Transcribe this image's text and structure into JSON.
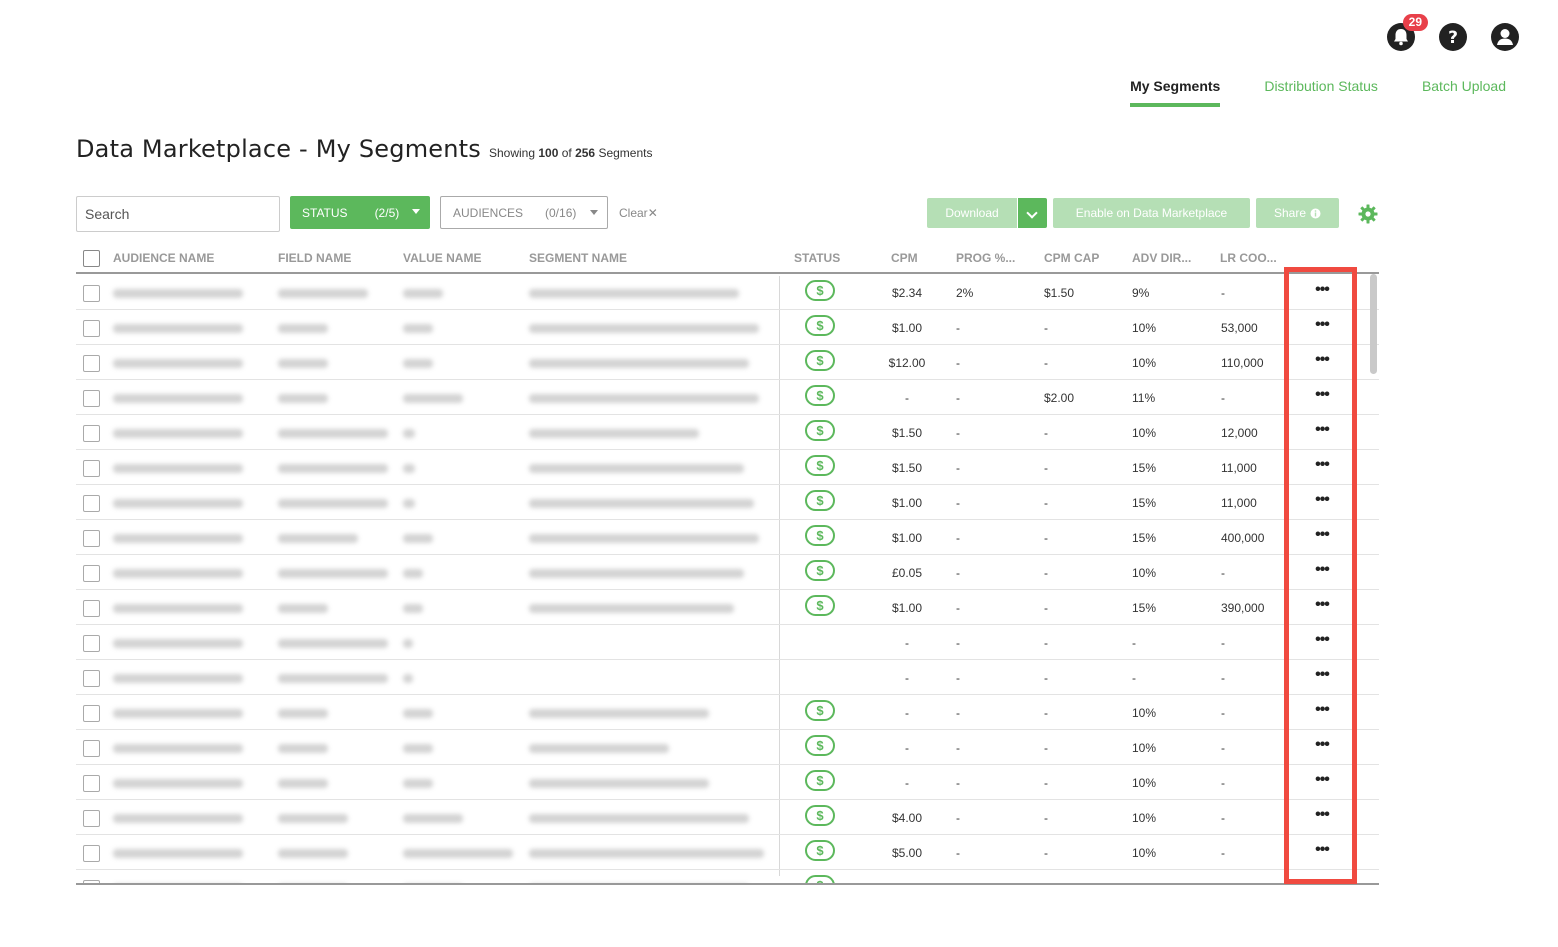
{
  "header": {
    "notifications_count": "29",
    "icons": [
      "bell-icon",
      "help-icon",
      "account-icon"
    ]
  },
  "tabs": [
    {
      "label": "My Segments",
      "active": true
    },
    {
      "label": "Distribution Status",
      "active": false
    },
    {
      "label": "Batch Upload",
      "active": false
    }
  ],
  "page": {
    "title": "Data Marketplace - My Segments",
    "showing_prefix": "Showing",
    "showing_count": "100",
    "showing_of": "of",
    "showing_total": "256",
    "showing_suffix": "Segments"
  },
  "toolbar": {
    "search_placeholder": "Search",
    "status_label": "STATUS",
    "status_count": "(2/5)",
    "audiences_label": "AUDIENCES",
    "audiences_count": "(0/16)",
    "clear_label": "Clear",
    "download_label": "Download",
    "enable_label": "Enable on Data Marketplace",
    "share_label": "Share"
  },
  "colors": {
    "accent": "#5cb85c",
    "accent_disabled": "#b5dfb5",
    "highlight": "#f04a40",
    "badge": "#e8404a"
  },
  "table": {
    "columns": [
      "AUDIENCE NAME",
      "FIELD NAME",
      "VALUE NAME",
      "SEGMENT NAME",
      "STATUS",
      "CPM",
      "PROG %...",
      "CPM CAP",
      "ADV DIR...",
      "LR COO..."
    ],
    "rows": [
      {
        "status": "$",
        "cpm": "$2.34",
        "prog": "2%",
        "cpm_cap": "$1.50",
        "adv": "9%",
        "lr": "-"
      },
      {
        "status": "$",
        "cpm": "$1.00",
        "prog": "-",
        "cpm_cap": "-",
        "adv": "10%",
        "lr": "53,000"
      },
      {
        "status": "$",
        "cpm": "$12.00",
        "prog": "-",
        "cpm_cap": "-",
        "adv": "10%",
        "lr": "110,000"
      },
      {
        "status": "$",
        "cpm": "-",
        "prog": "-",
        "cpm_cap": "$2.00",
        "adv": "11%",
        "lr": "-"
      },
      {
        "status": "$",
        "cpm": "$1.50",
        "prog": "-",
        "cpm_cap": "-",
        "adv": "10%",
        "lr": "12,000"
      },
      {
        "status": "$",
        "cpm": "$1.50",
        "prog": "-",
        "cpm_cap": "-",
        "adv": "15%",
        "lr": "11,000"
      },
      {
        "status": "$",
        "cpm": "$1.00",
        "prog": "-",
        "cpm_cap": "-",
        "adv": "15%",
        "lr": "11,000"
      },
      {
        "status": "$",
        "cpm": "$1.00",
        "prog": "-",
        "cpm_cap": "-",
        "adv": "15%",
        "lr": "400,000"
      },
      {
        "status": "$",
        "cpm": "£0.05",
        "prog": "-",
        "cpm_cap": "-",
        "adv": "10%",
        "lr": "-"
      },
      {
        "status": "$",
        "cpm": "$1.00",
        "prog": "-",
        "cpm_cap": "-",
        "adv": "15%",
        "lr": "390,000"
      },
      {
        "status": "",
        "cpm": "-",
        "prog": "-",
        "cpm_cap": "-",
        "adv": "-",
        "lr": "-"
      },
      {
        "status": "",
        "cpm": "-",
        "prog": "-",
        "cpm_cap": "-",
        "adv": "-",
        "lr": "-"
      },
      {
        "status": "$",
        "cpm": "-",
        "prog": "-",
        "cpm_cap": "-",
        "adv": "10%",
        "lr": "-"
      },
      {
        "status": "$",
        "cpm": "-",
        "prog": "-",
        "cpm_cap": "-",
        "adv": "10%",
        "lr": "-"
      },
      {
        "status": "$",
        "cpm": "-",
        "prog": "-",
        "cpm_cap": "-",
        "adv": "10%",
        "lr": "-"
      },
      {
        "status": "$",
        "cpm": "$4.00",
        "prog": "-",
        "cpm_cap": "-",
        "adv": "10%",
        "lr": "-"
      },
      {
        "status": "$",
        "cpm": "$5.00",
        "prog": "-",
        "cpm_cap": "-",
        "adv": "10%",
        "lr": "-"
      },
      {
        "status": "$",
        "cpm": "",
        "prog": "",
        "cpm_cap": "",
        "adv": "",
        "lr": ""
      }
    ],
    "actions_label": "•••"
  }
}
